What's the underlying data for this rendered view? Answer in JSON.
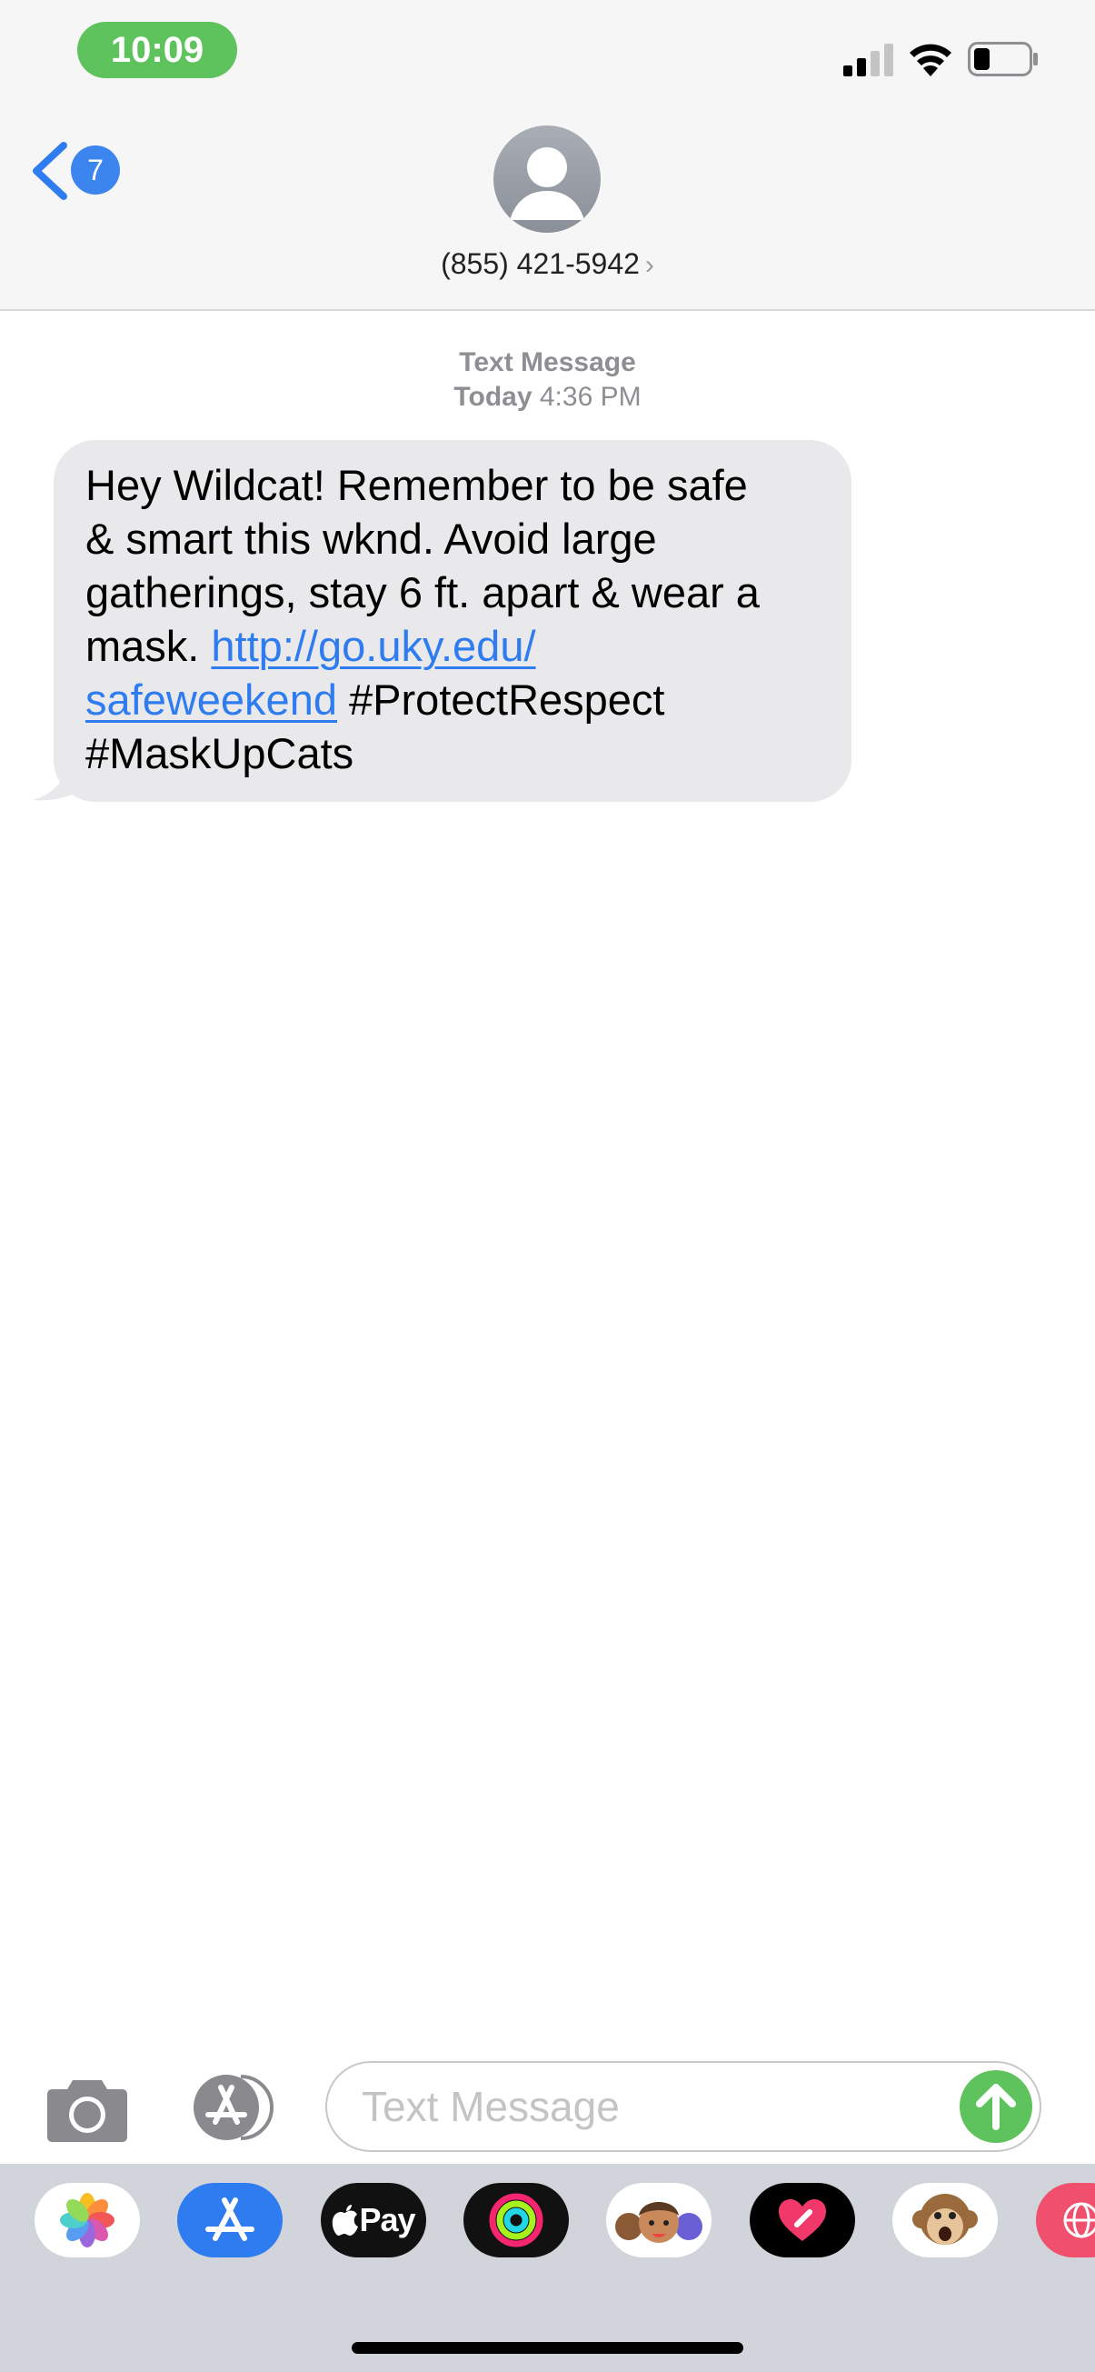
{
  "status_bar": {
    "time": "10:09",
    "signal_bars": 2,
    "battery_level": 0.3
  },
  "header": {
    "back_badge_count": "7",
    "contact_name": "(855) 421-5942",
    "contact_chevron": "›",
    "avatar_icon": "person-silhouette-icon"
  },
  "conversation": {
    "service_label": "Text Message",
    "date_label": "Today",
    "time_label": "4:36 PM",
    "message": {
      "line1": "Hey Wildcat! Remember to be safe",
      "line2": "& smart this wknd. Avoid large",
      "line3": "gatherings, stay 6 ft. apart & wear a",
      "line4_text": "mask. ",
      "link_part1": "http://go.uky.edu/",
      "link_part2": "safeweekend",
      "line5_text": " #ProtectRespect",
      "line6": "#MaskUpCats"
    }
  },
  "input_bar": {
    "placeholder": "Text Message",
    "camera_icon": "camera-icon",
    "apps_icon": "app-store-icon",
    "send_icon": "arrow-up-icon"
  },
  "app_drawer": {
    "apps": [
      {
        "name": "photos-app-icon",
        "label": ""
      },
      {
        "name": "app-store-app-icon",
        "label": ""
      },
      {
        "name": "apple-pay-app-icon",
        "label": "Pay"
      },
      {
        "name": "activity-app-icon",
        "label": ""
      },
      {
        "name": "memoji-app-icon",
        "label": ""
      },
      {
        "name": "digital-touch-app-icon",
        "label": ""
      },
      {
        "name": "animoji-app-icon",
        "label": ""
      },
      {
        "name": "web-images-app-icon",
        "label": ""
      }
    ]
  },
  "colors": {
    "accent_blue": "#2f7cf0",
    "send_green": "#5ec35d",
    "bubble_gray": "#e9e9eb"
  }
}
